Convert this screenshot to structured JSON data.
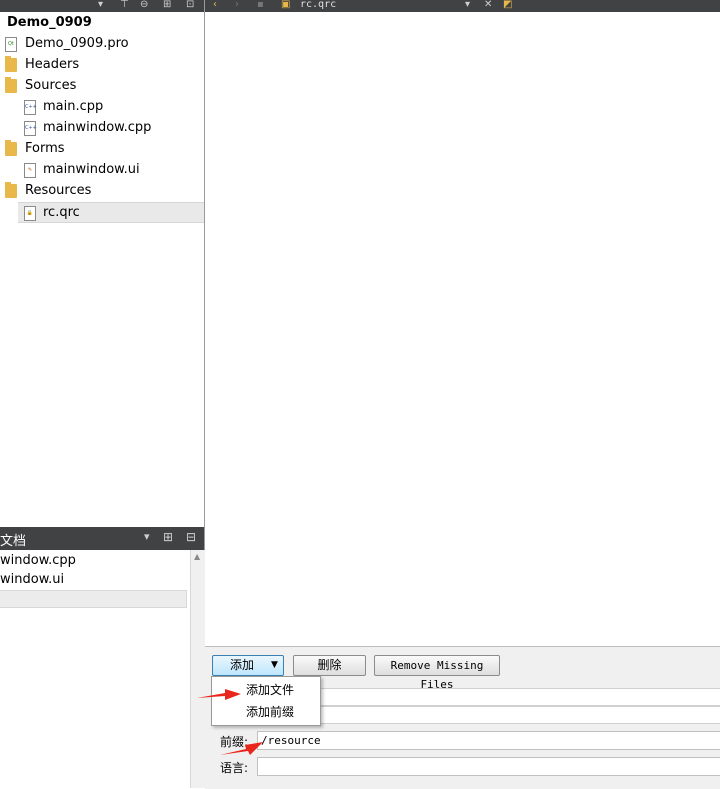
{
  "project_tree": {
    "root": "Demo_0909",
    "items": [
      {
        "label": "Demo_0909.pro",
        "kind": "pro-file"
      },
      {
        "label": "Headers",
        "kind": "folder"
      },
      {
        "label": "Sources",
        "kind": "folder"
      },
      {
        "label": "main.cpp",
        "kind": "cpp-file"
      },
      {
        "label": "mainwindow.cpp",
        "kind": "cpp-file"
      },
      {
        "label": "Forms",
        "kind": "folder"
      },
      {
        "label": "mainwindow.ui",
        "kind": "ui-file"
      },
      {
        "label": "Resources",
        "kind": "folder"
      },
      {
        "label": "rc.qrc",
        "kind": "qrc-file"
      }
    ]
  },
  "editor_tab": {
    "filename": "rc.qrc"
  },
  "open_documents": {
    "title": "文档",
    "items": [
      "window.cpp",
      "window.ui"
    ]
  },
  "resource_editor": {
    "add_label": "添加",
    "remove_label": "删除",
    "remove_missing_label": "Remove Missing Files",
    "add_menu": [
      "添加文件",
      "添加前缀"
    ],
    "prefix_label": "前缀:",
    "prefix_value": "/resource",
    "language_label": "语言:",
    "language_value": ""
  },
  "colors": {
    "toolbar_bg": "#404244",
    "folder": "#e8b84a",
    "annotation_arrow": "#e8261c"
  }
}
